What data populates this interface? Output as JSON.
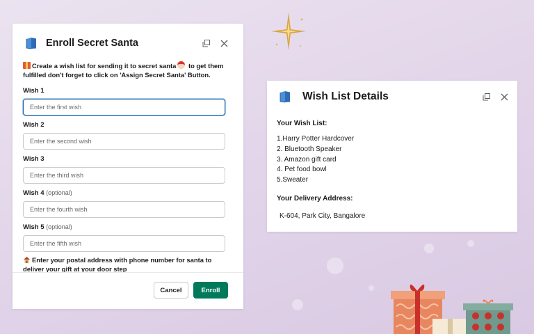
{
  "enroll_modal": {
    "title": "Enroll Secret Santa",
    "intro_part1": "Create a wish list for sending it to secret santa",
    "intro_part2": " to get them fulfilled don't forget to click on 'Assign Secret Santa' Button.",
    "fields": [
      {
        "label": "Wish 1",
        "optional": "",
        "placeholder": "Enter the first wish",
        "value": ""
      },
      {
        "label": "Wish 2",
        "optional": "",
        "placeholder": "Enter the second wish",
        "value": ""
      },
      {
        "label": "Wish 3",
        "optional": "",
        "placeholder": "Enter the third wish",
        "value": ""
      },
      {
        "label": "Wish 4",
        "optional": "(optional)",
        "placeholder": "Enter the fourth wish",
        "value": ""
      },
      {
        "label": "Wish 5",
        "optional": "(optional)",
        "placeholder": "Enter the fifth wish",
        "value": ""
      }
    ],
    "address_note": "Enter your postal address with phone number for santa to deliver your gift at your door step",
    "cancel_label": "Cancel",
    "enroll_label": "Enroll"
  },
  "wishlist_modal": {
    "title": "Wish List Details",
    "wish_list_label": "Your Wish List:",
    "wishes": [
      "1.Harry Potter Hardcover",
      "2. Bluetooth Speaker",
      "3. Amazon gift card",
      "4. Pet food bowl",
      "5.Sweater"
    ],
    "address_label": "Your Delivery Address:",
    "address": "K-604, Park City, Bangalore"
  },
  "icons": {
    "app": "book-icon",
    "expand": "expand-icon",
    "close": "close-icon",
    "gift_emoji": "gift-icon",
    "santa_emoji": "santa-icon",
    "house_emoji": "house-icon"
  },
  "colors": {
    "primary_button": "#007a5a",
    "focus_border": "#1d64a8",
    "background": "#e3d6ea"
  }
}
